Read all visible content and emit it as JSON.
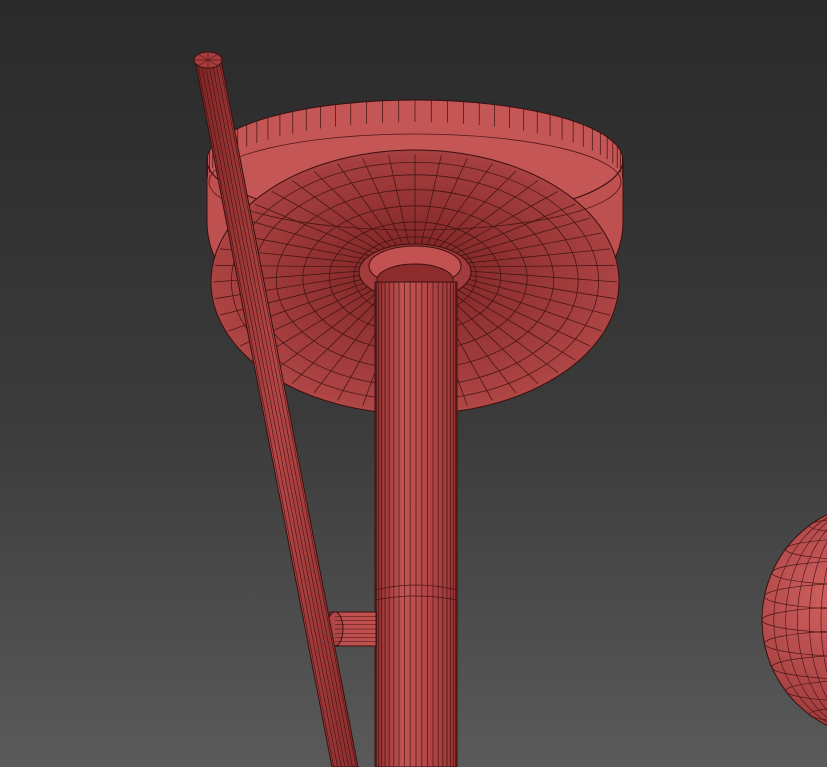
{
  "viewport": {
    "background_top": "#2a2a2a",
    "background_bottom": "#5a5a5a"
  },
  "model": {
    "color": "#b84a4a",
    "shadow_color": "#6e1e1e",
    "wire_color": "#3a0f0f",
    "display_mode": "wireframe-on-shaded"
  }
}
